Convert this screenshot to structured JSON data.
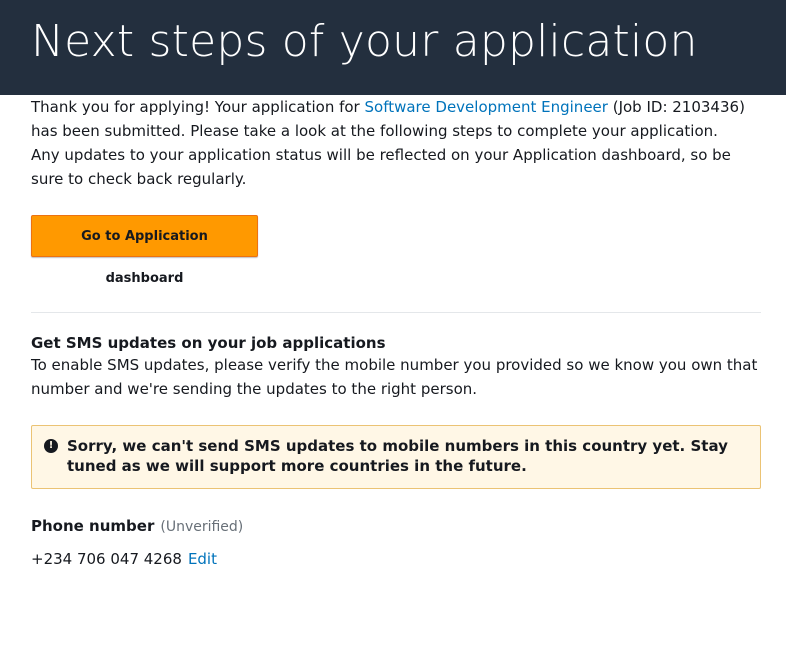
{
  "header": {
    "title": "Next steps of your application"
  },
  "intro": {
    "text_before_link": "Thank you for applying! Your application for ",
    "job_link": "Software Development Engineer",
    "text_after_link": " (Job ID: 2103436) has been submitted. Please take a look at the following steps to complete your application."
  },
  "status_note": "Any updates to your application status will be reflected on your Application dashboard, so be sure to check back regularly.",
  "cta": {
    "label": "Go to Application dashboard"
  },
  "sms": {
    "title": "Get SMS updates on your job applications",
    "description": "To enable SMS updates, please verify the mobile number you provided so we know you own that number and we're sending the updates to the right person.",
    "alert_icon": "!",
    "alert_text": "Sorry, we can't send SMS updates to mobile numbers in this country yet. Stay tuned as we will support more countries in the future."
  },
  "phone": {
    "label": "Phone number",
    "status": "(Unverified)",
    "number": "+234 706 047 4268",
    "edit_label": "Edit"
  },
  "colors": {
    "header_bg": "#232f3e",
    "primary_button": "#ff9900",
    "link": "#0073bb",
    "alert_bg": "#fff7e6",
    "alert_border": "#ebc374"
  }
}
